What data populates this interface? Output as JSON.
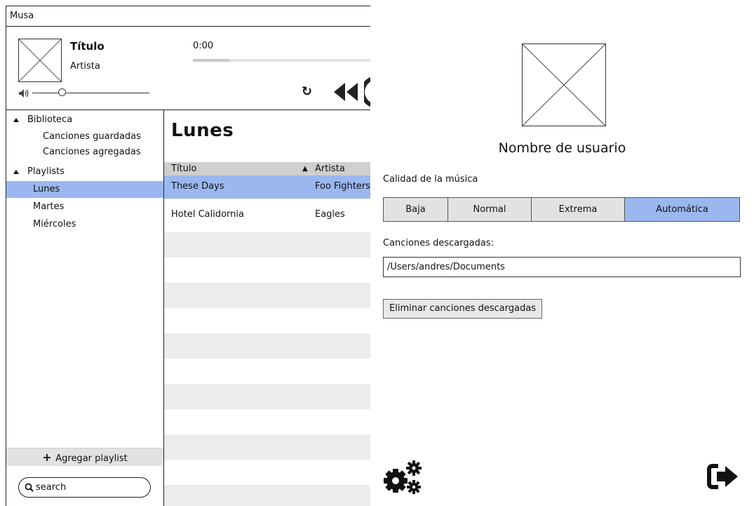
{
  "app": {
    "title": "Musa"
  },
  "player": {
    "track_title": "Título",
    "track_artist": "Artista",
    "time_current": "0:00",
    "progress": 0.2,
    "volume": 0.25,
    "icons": [
      "album-art-placeholder",
      "volume-icon",
      "repeat-icon",
      "previous-icon",
      "play-icon"
    ]
  },
  "sidebar": {
    "sections": [
      {
        "label": "Biblioteca",
        "items": [
          "Canciones guardadas",
          "Canciones agregadas"
        ]
      },
      {
        "label": "Playlists",
        "items": [
          "Lunes",
          "Martes",
          "Miércoles"
        ]
      }
    ],
    "selected": "Lunes",
    "add_playlist": "Agregar playlist",
    "search_placeholder": "search"
  },
  "playlist": {
    "title": "Lunes",
    "columns": [
      "Título",
      "Artista"
    ],
    "sort_column": "Artista",
    "rows": [
      {
        "title": "These Days",
        "artist": "Foo Fighters",
        "selected": true
      },
      {
        "title": "Hotel Calidornia",
        "artist": "Eagles",
        "selected": false
      }
    ]
  },
  "settings": {
    "username": "Nombre de usuario",
    "quality_label": "Calidad de la música",
    "quality_options": [
      "Baja",
      "Normal",
      "Extrema",
      "Automática"
    ],
    "quality_selected": "Automática",
    "downloads_label": "Canciones descargadas:",
    "downloads_path": "/Users/andres/Documents",
    "delete_button": "Eliminar canciones descargadas",
    "icons": [
      "avatar-placeholder",
      "gears-icon",
      "logout-icon"
    ]
  },
  "colors": {
    "selected": "#9ab8ef",
    "header": "#cfcfcf",
    "alt_row": "#ececec",
    "button": "#e2e2e2"
  }
}
